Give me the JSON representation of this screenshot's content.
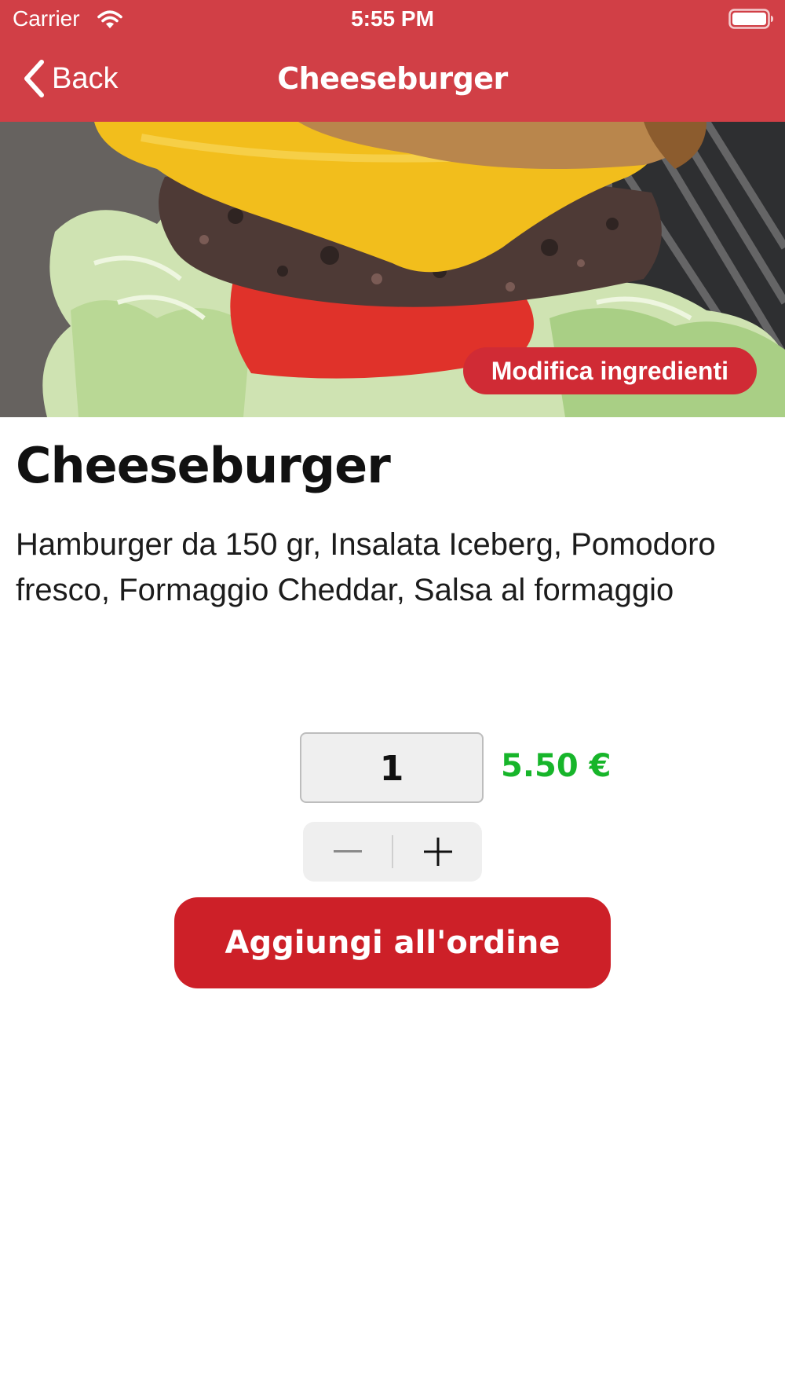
{
  "status_bar": {
    "carrier": "Carrier",
    "time": "5:55 PM",
    "wifi_icon": "wifi-icon",
    "battery_icon": "battery-icon"
  },
  "nav": {
    "back_label": "Back",
    "back_icon": "chevron-left-icon",
    "title": "Cheeseburger"
  },
  "hero": {
    "image": "cheeseburger-photo",
    "modify_label": "Modifica ingredienti"
  },
  "product": {
    "name": "Cheeseburger",
    "description": "Hamburger da 150 gr, Insalata Iceberg, Pomodoro fresco, Formaggio Cheddar, Salsa al formaggio",
    "quantity": "1",
    "price": "5.50 €"
  },
  "stepper": {
    "minus_icon": "minus-icon",
    "plus_icon": "plus-icon"
  },
  "actions": {
    "add_to_order_label": "Aggiungi all'ordine"
  },
  "colors": {
    "header": "#d13f46",
    "accent_button": "#cd2028",
    "price": "#17b52a"
  }
}
